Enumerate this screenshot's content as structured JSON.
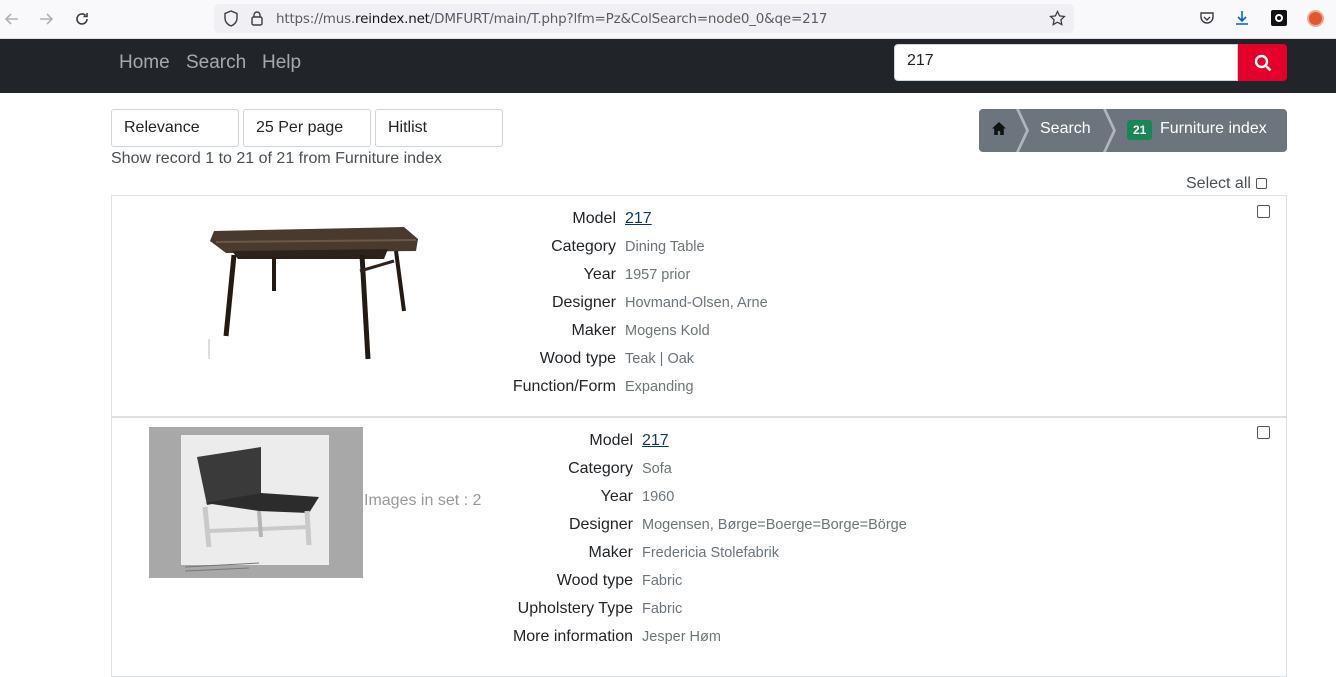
{
  "browser": {
    "url_prefix": "https://mus.",
    "url_domain": "reindex.net",
    "url_path": "/DMFURT/main/T.php?lfm=Pz&ColSearch=node0_0&qe=217"
  },
  "navbar": {
    "links": [
      "Home",
      "Search",
      "Help"
    ],
    "search_value": "217"
  },
  "toolbar": {
    "sort": "Relevance",
    "per_page": "25 Per page",
    "view": "Hitlist",
    "record_count": "Show record 1 to 21 of 21 from Furniture index"
  },
  "breadcrumb": {
    "search": "Search",
    "badge": "21",
    "index": "Furniture index"
  },
  "select_all": "Select all",
  "records": [
    {
      "fields": [
        {
          "label": "Model",
          "value": "217"
        },
        {
          "label": "Category",
          "value": "Dining Table"
        },
        {
          "label": "Year",
          "value": "1957 prior"
        },
        {
          "label": "Designer",
          "value": "Hovmand-Olsen, Arne"
        },
        {
          "label": "Maker",
          "value": "Mogens Kold"
        },
        {
          "label": "Wood type",
          "value": "Teak | Oak"
        },
        {
          "label": "Function/Form",
          "value": "Expanding"
        }
      ]
    },
    {
      "images_in_set": "Images in set : 2",
      "fields": [
        {
          "label": "Model",
          "value": "217"
        },
        {
          "label": "Category",
          "value": "Sofa"
        },
        {
          "label": "Year",
          "value": "1960"
        },
        {
          "label": "Designer",
          "value": "Mogensen, Børge=Boerge=Borge=Börge"
        },
        {
          "label": "Maker",
          "value": "Fredericia Stolefabrik"
        },
        {
          "label": "Wood type",
          "value": "Fabric"
        },
        {
          "label": "Upholstery Type",
          "value": "Fabric"
        },
        {
          "label": "More information",
          "value": "Jesper Høm"
        }
      ]
    }
  ],
  "colors": {
    "navbar": "#212529",
    "search_button": "#e4002b",
    "breadcrumb": "#6c757d",
    "badge": "#198754"
  }
}
